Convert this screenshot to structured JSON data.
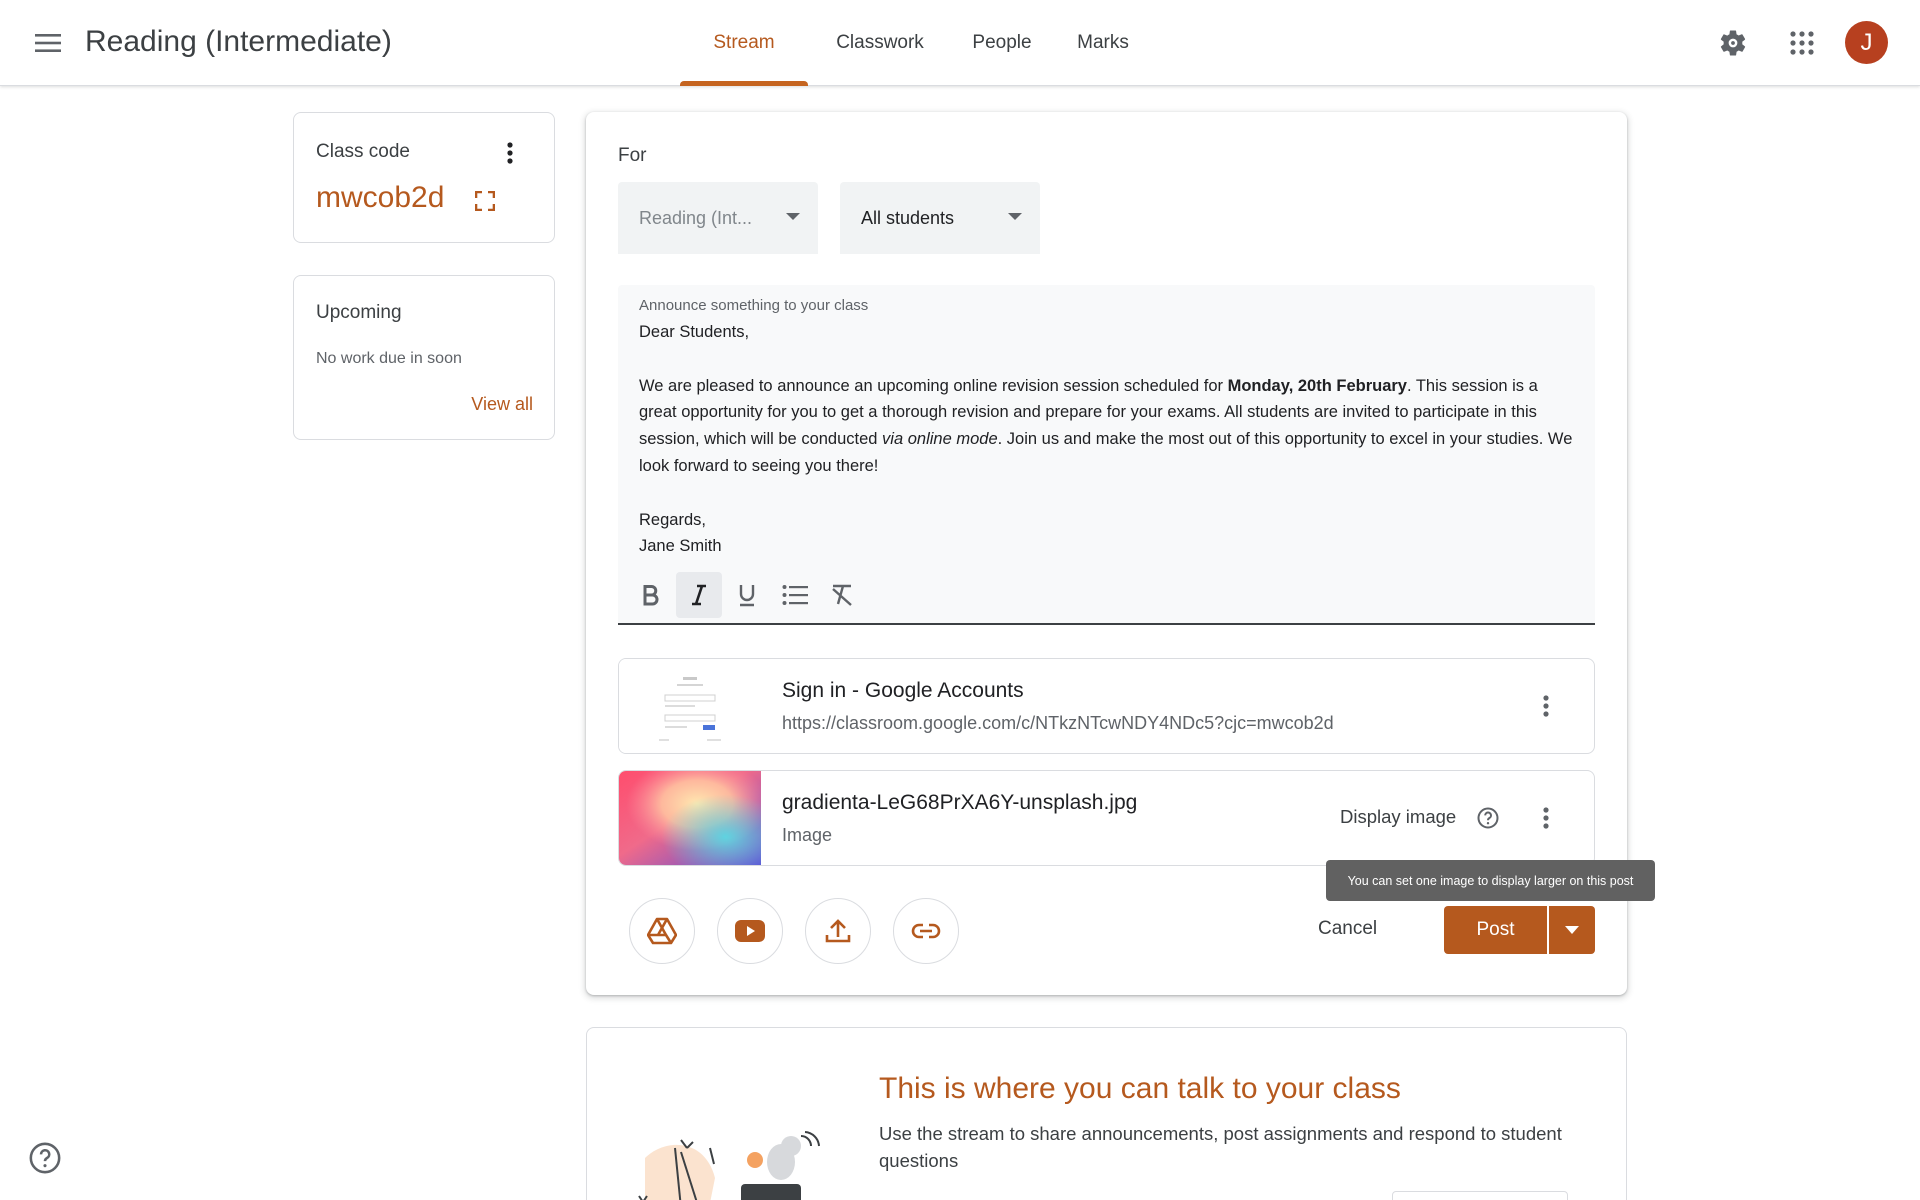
{
  "header": {
    "class_title": "Reading (Intermediate)",
    "tabs": [
      {
        "label": "Stream",
        "active": true
      },
      {
        "label": "Classwork",
        "active": false
      },
      {
        "label": "People",
        "active": false
      },
      {
        "label": "Marks",
        "active": false
      }
    ],
    "avatar_initial": "J"
  },
  "class_code_card": {
    "label": "Class code",
    "code": "mwcob2d"
  },
  "upcoming_card": {
    "title": "Upcoming",
    "empty_text": "No work due in soon",
    "view_all": "View all"
  },
  "compose": {
    "for_label": "For",
    "class_select": "Reading (Int...",
    "audience_select": "All students",
    "editor_label": "Announce something to your class",
    "greeting": "Dear Students,",
    "body_1": "We are pleased to announce an upcoming online revision session scheduled for ",
    "body_bold": "Monday, 20th February",
    "body_2": ". This session is a great opportunity for you to get a thorough revision and prepare for your exams. All students are invited to participate in this session, which will be conducted ",
    "body_italic": "via online mode",
    "body_3": ". Join us and make the most out of this opportunity to excel in your studies. We look forward to seeing you there!",
    "closing": "Regards,",
    "signature": "Jane Smith",
    "attachments": [
      {
        "title": "Sign in - Google Accounts",
        "subtitle": "https://classroom.google.com/c/NTkzNTcwNDY4NDc5?cjc=mwcob2d"
      },
      {
        "title": "gradienta-LeG68PrXA6Y-unsplash.jpg",
        "subtitle": "Image"
      }
    ],
    "display_image_label": "Display image",
    "tooltip": "You can set one image to display larger on this post",
    "cancel_label": "Cancel",
    "post_label": "Post"
  },
  "welcome_card": {
    "title": "This is where you can talk to your class",
    "text": "Use the stream to share announcements, post assignments and respond to student questions"
  },
  "colors": {
    "accent": "#b5591e",
    "avatar": "#b7401f"
  },
  "icons": [
    "menu-icon",
    "settings-icon",
    "apps-icon",
    "more-vert-icon",
    "expand-icon",
    "bold-icon",
    "italic-icon",
    "underline-icon",
    "bulleted-list-icon",
    "clear-formatting-icon",
    "help-icon",
    "google-drive-icon",
    "youtube-icon",
    "upload-icon",
    "link-icon",
    "dropdown-arrow-icon"
  ]
}
